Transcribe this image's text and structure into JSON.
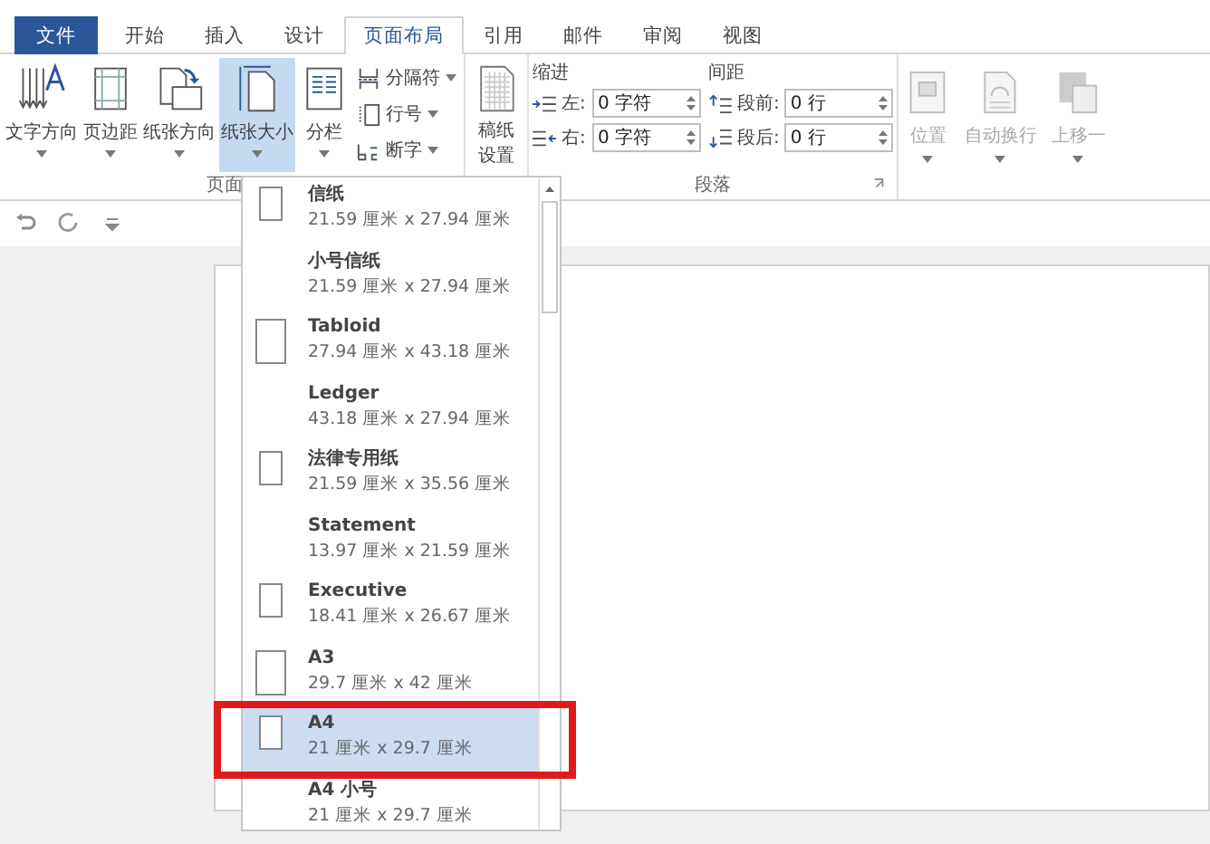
{
  "tabs": [
    {
      "label": "文件",
      "kind": "file",
      "selected": false
    },
    {
      "label": "开始",
      "kind": "tab",
      "selected": false
    },
    {
      "label": "插入",
      "kind": "tab",
      "selected": false
    },
    {
      "label": "设计",
      "kind": "tab",
      "selected": false
    },
    {
      "label": "页面布局",
      "kind": "tab",
      "selected": true
    },
    {
      "label": "引用",
      "kind": "tab",
      "selected": false
    },
    {
      "label": "邮件",
      "kind": "tab",
      "selected": false
    },
    {
      "label": "审阅",
      "kind": "tab",
      "selected": false
    },
    {
      "label": "视图",
      "kind": "tab",
      "selected": false
    }
  ],
  "page_setup": {
    "label": "页面",
    "large_buttons": [
      {
        "label": "文字方向",
        "selected": false
      },
      {
        "label": "页边距",
        "selected": false
      },
      {
        "label": "纸张方向",
        "selected": false
      },
      {
        "label": "纸张大小",
        "selected": true
      },
      {
        "label": "分栏",
        "selected": false
      }
    ],
    "small_buttons": [
      {
        "label": "分隔符"
      },
      {
        "label": "行号"
      },
      {
        "label": "断字"
      }
    ]
  },
  "manuscript": {
    "label": "稿纸设置"
  },
  "paragraph": {
    "label": "段落",
    "indent": {
      "label": "缩进",
      "fields": [
        {
          "label": "左:",
          "value": "0 字符"
        },
        {
          "label": "右:",
          "value": "0 字符"
        }
      ]
    },
    "spacing": {
      "label": "间距",
      "fields": [
        {
          "label": "段前:",
          "value": "0 行"
        },
        {
          "label": "段后:",
          "value": "0 行"
        }
      ]
    }
  },
  "arrange": {
    "disabled": true,
    "buttons": [
      {
        "label": "位置"
      },
      {
        "label": "自动换行"
      },
      {
        "label": "上移一"
      }
    ]
  },
  "paper_sizes": [
    {
      "name": "信纸",
      "size": "21.59 厘米 x 27.94 厘米",
      "kind": "small",
      "selected": false,
      "outlined": false
    },
    {
      "name": "小号信纸",
      "size": "21.59 厘米 x 27.94 厘米",
      "kind": "plain",
      "selected": false,
      "outlined": false
    },
    {
      "name": "Tabloid",
      "size": "27.94 厘米 x 43.18 厘米",
      "kind": "large",
      "selected": false,
      "outlined": false
    },
    {
      "name": "Ledger",
      "size": "43.18 厘米 x 27.94 厘米",
      "kind": "plain",
      "selected": false,
      "outlined": false
    },
    {
      "name": "法律专用纸",
      "size": "21.59 厘米 x 35.56 厘米",
      "kind": "small",
      "selected": false,
      "outlined": false
    },
    {
      "name": "Statement",
      "size": "13.97 厘米 x 21.59 厘米",
      "kind": "plain",
      "selected": false,
      "outlined": false
    },
    {
      "name": "Executive",
      "size": "18.41 厘米 x 26.67 厘米",
      "kind": "small",
      "selected": false,
      "outlined": false
    },
    {
      "name": "A3",
      "size": "29.7 厘米 x 42 厘米",
      "kind": "large",
      "selected": false,
      "outlined": false
    },
    {
      "name": "A4",
      "size": "21 厘米 x 29.7 厘米",
      "kind": "small",
      "selected": true,
      "outlined": true
    },
    {
      "name": "A4 小号",
      "size": "21 厘米 x 29.7 厘米",
      "kind": "plain",
      "selected": false,
      "outlined": false
    }
  ]
}
